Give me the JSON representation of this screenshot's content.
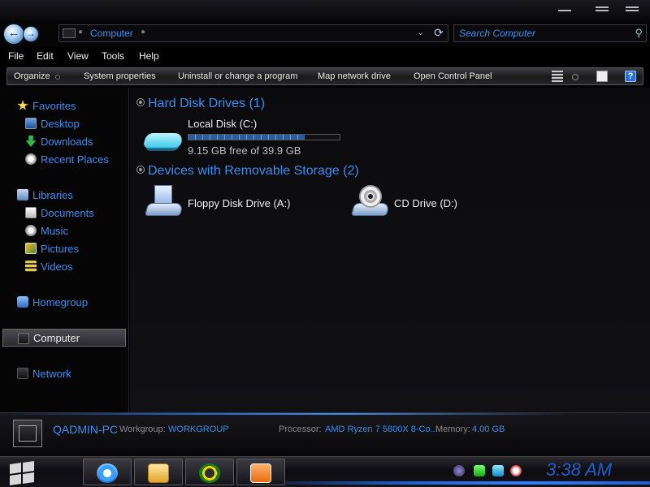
{
  "window": {
    "minimize_glyph": "—",
    "maximize_glyph": "=",
    "close_glyph": "="
  },
  "address": {
    "crumb": "Computer",
    "search_placeholder": "Search Computer"
  },
  "menu": [
    "File",
    "Edit",
    "View",
    "Tools",
    "Help"
  ],
  "toolbar": {
    "organize": "Organize",
    "system_properties": "System properties",
    "uninstall": "Uninstall or change a program",
    "map_drive": "Map network drive",
    "control_panel": "Open Control Panel",
    "help_glyph": "?"
  },
  "nav": {
    "favorites": "Favorites",
    "desktop": "Desktop",
    "downloads": "Downloads",
    "recent": "Recent Places",
    "libraries": "Libraries",
    "documents": "Documents",
    "music": "Music",
    "pictures": "Pictures",
    "videos": "Videos",
    "homegroup": "Homegroup",
    "computer": "Computer",
    "network": "Network"
  },
  "groups": {
    "hdd": "Hard Disk Drives (1)",
    "removable": "Devices with Removable Storage (2)"
  },
  "drives": {
    "local": {
      "name": "Local Disk (C:)",
      "free_text": "9.15 GB free of 39.9 GB",
      "used_fraction": 0.77
    },
    "floppy": {
      "name": "Floppy Disk Drive (A:)"
    },
    "cd": {
      "name": "CD Drive (D:)"
    }
  },
  "details": {
    "pc_name": "QADMIN-PC",
    "workgroup_label": "Workgroup:",
    "workgroup_value": "WORKGROUP",
    "processor_label": "Processor:",
    "processor_value": "AMD Ryzen 7 5800X 8-Co...",
    "memory_label": "Memory:",
    "memory_value": "4.00 GB"
  },
  "taskbar": {
    "clock": "3:38 AM"
  },
  "colors": {
    "accent": "#3a8df0",
    "background": "#0b0b0d"
  }
}
